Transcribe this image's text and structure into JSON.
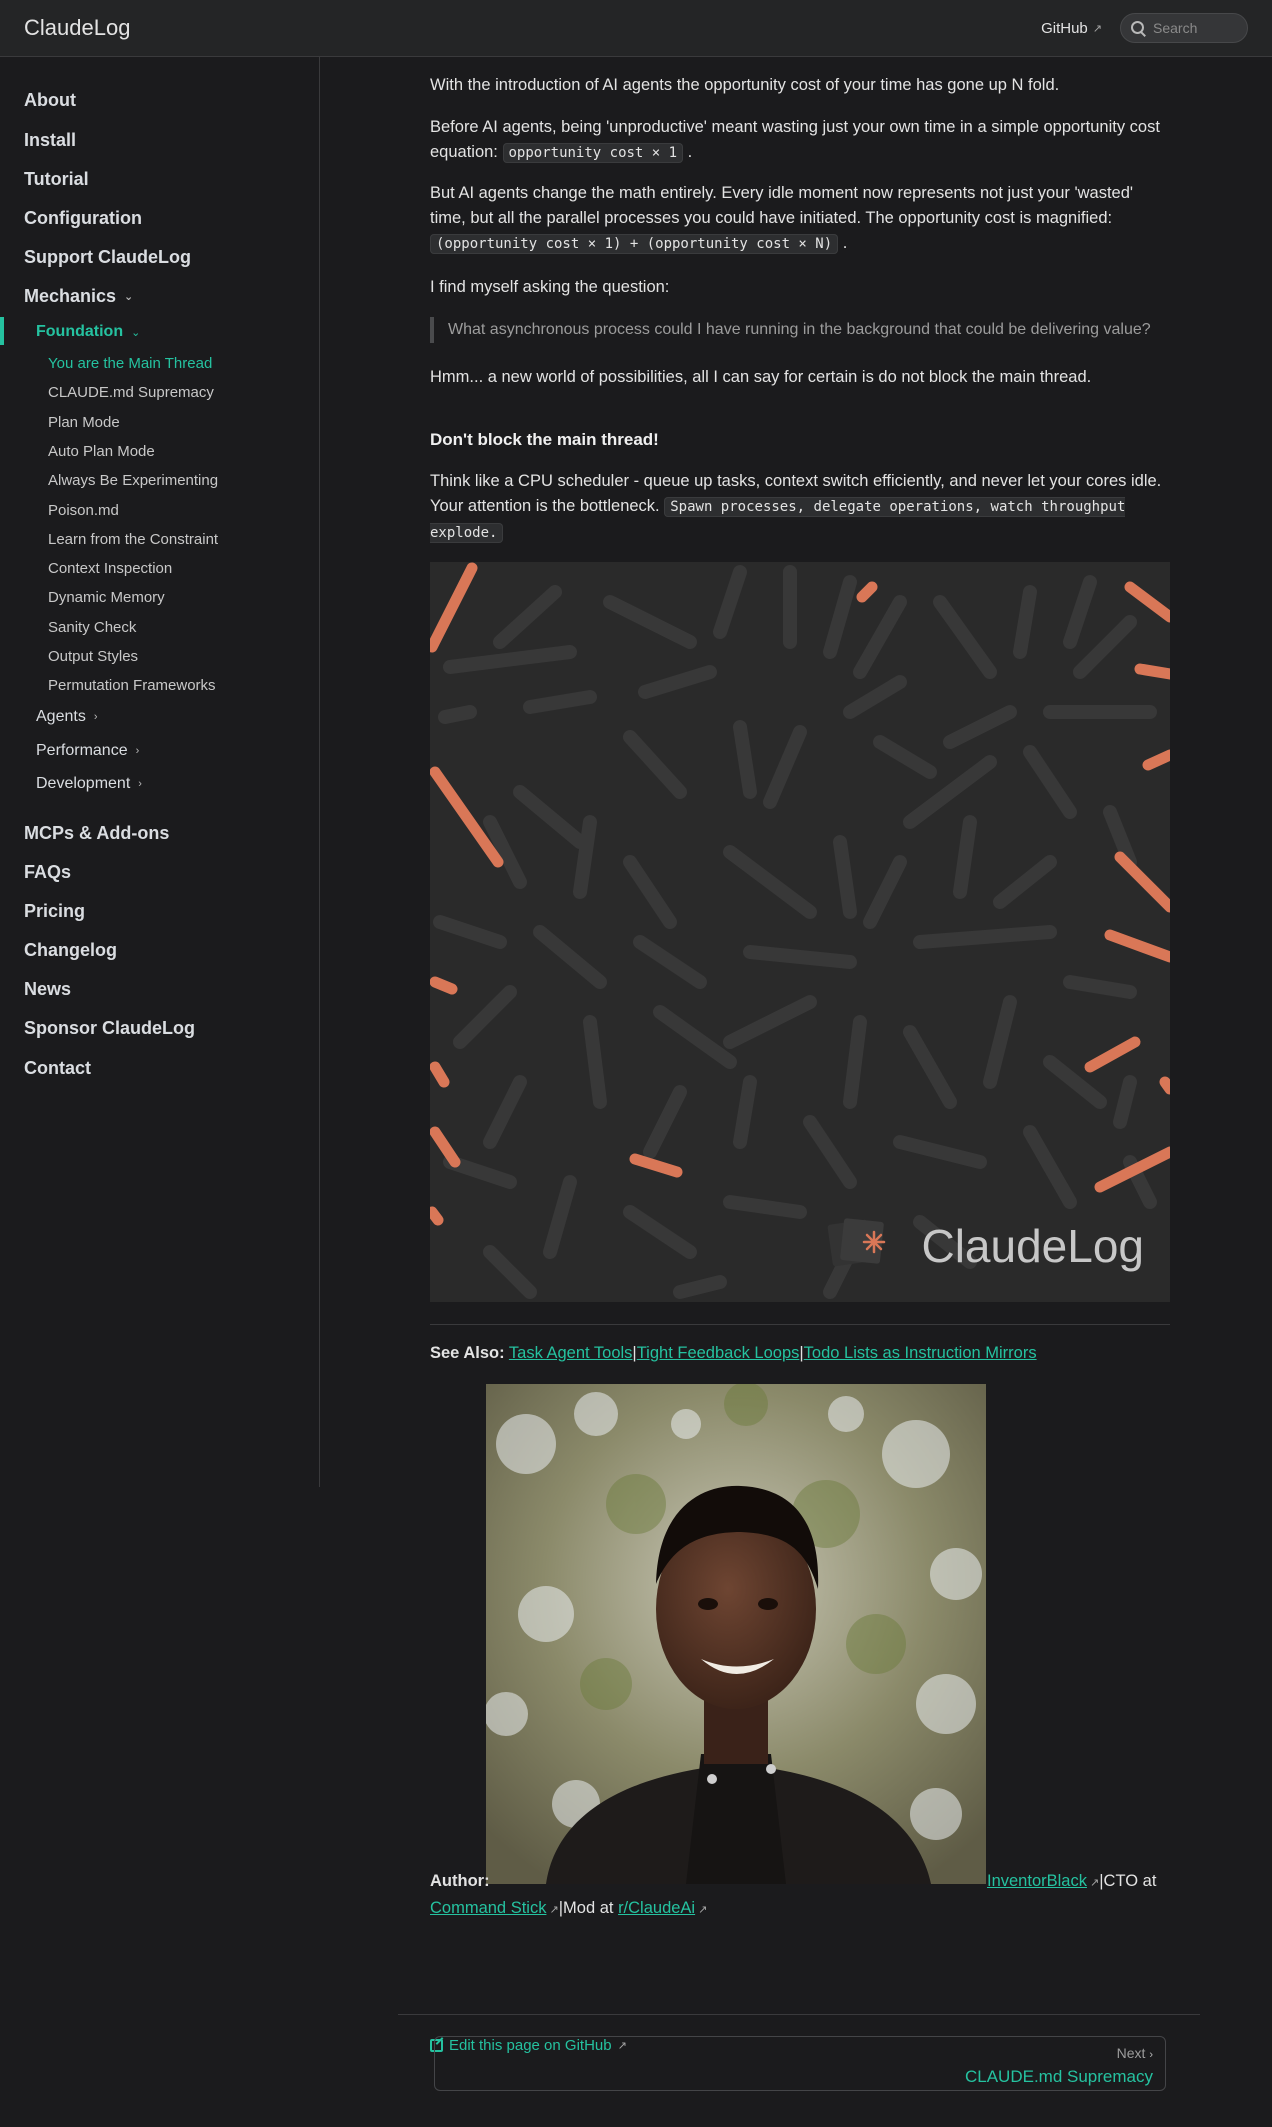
{
  "header": {
    "brand": "ClaudeLog",
    "github": "GitHub",
    "search_placeholder": "Search"
  },
  "sidebar": {
    "top_items": [
      "About",
      "Install",
      "Tutorial",
      "Configuration",
      "Support ClaudeLog",
      "Mechanics"
    ],
    "foundation": "Foundation",
    "foundation_items": [
      "You are the Main Thread",
      "CLAUDE.md Supremacy",
      "Plan Mode",
      "Auto Plan Mode",
      "Always Be Experimenting",
      "Poison.md",
      "Learn from the Constraint",
      "Context Inspection",
      "Dynamic Memory",
      "Sanity Check",
      "Output Styles",
      "Permutation Frameworks"
    ],
    "subsections": [
      "Agents",
      "Performance",
      "Development"
    ],
    "bottom_items": [
      "MCPs & Add-ons",
      "FAQs",
      "Pricing",
      "Changelog",
      "News",
      "Sponsor ClaudeLog",
      "Contact"
    ]
  },
  "content": {
    "p1": "With the introduction of AI agents the opportunity cost of your time has gone up N fold.",
    "p2_text": "Before AI agents, being 'unproductive' meant wasting just your own time in a simple opportunity cost equation:",
    "p2_code": "opportunity cost × 1",
    "p3_text": "But AI agents change the math entirely. Every idle moment now represents not just your 'wasted' time, but all the parallel processes you could have initiated. The opportunity cost is magnified:",
    "p3_code": "(opportunity cost × 1) + (opportunity cost × N)",
    "p4": "I find myself asking the question:",
    "quote": "What asynchronous process could I have running in the background that could be delivering value?",
    "p5": "Hmm... a new world of possibilities, all I can say for certain is do not block the main thread.",
    "h3": "Don't block the main thread!",
    "p6_text": "Think like a CPU scheduler - queue up tasks, context switch efficiently, and never let your cores idle. Your attention is the bottleneck.",
    "p6_code": "Spawn processes, delegate operations, watch throughput explode.",
    "hero_wordmark": "ClaudeLog",
    "see_also_label": "See Also:",
    "see_also_links": [
      "Task Agent Tools",
      "Tight Feedback Loops",
      "Todo Lists as Instruction Mirrors"
    ],
    "author_label": "Author:",
    "author_name": "InventorBlack",
    "cto_text": "|CTO at",
    "company": "Command Stick",
    "mod_text": "|Mod at",
    "subreddit": "r/ClaudeAi",
    "edit_link": "Edit this page on GitHub"
  },
  "pager": {
    "next_label": "Next",
    "next_title": "CLAUDE.md Supremacy"
  },
  "colors": {
    "accent": "#25c2a0",
    "background": "#1b1b1d",
    "hero_orange": "#d97757"
  }
}
